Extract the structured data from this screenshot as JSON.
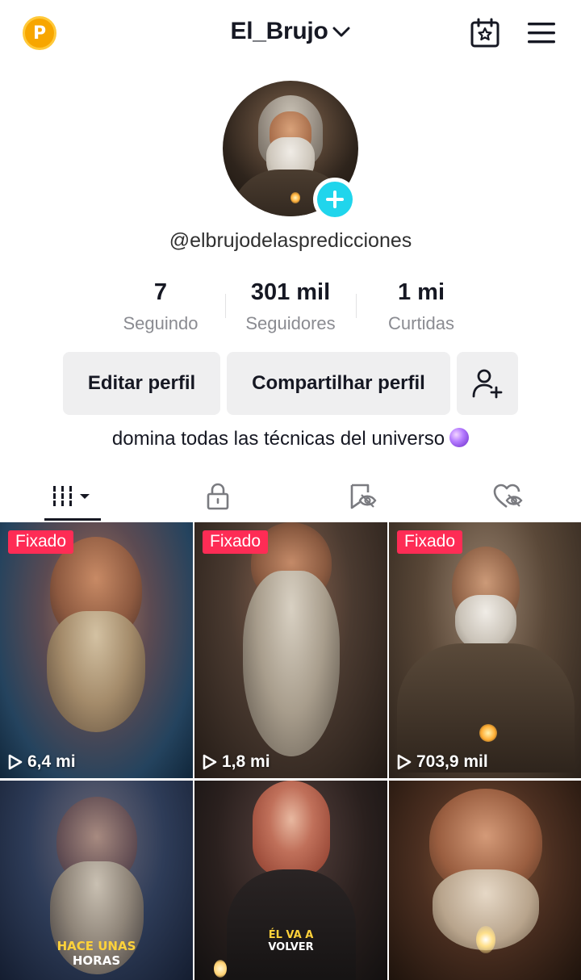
{
  "header": {
    "title": "El_Brujo",
    "coin_icon": "p-coin-icon",
    "calendar_icon": "calendar-star-icon",
    "menu_icon": "hamburger-menu-icon"
  },
  "profile": {
    "username": "@elbrujodelaspredicciones",
    "bio": "domina todas las técnicas del universo",
    "bio_emoji": "crystal-ball"
  },
  "stats": [
    {
      "value": "7",
      "label": "Seguindo"
    },
    {
      "value": "301 mil",
      "label": "Seguidores"
    },
    {
      "value": "1 mi",
      "label": "Curtidas"
    }
  ],
  "buttons": {
    "edit": "Editar perfil",
    "share": "Compartilhar perfil"
  },
  "tabs": [
    "videos-grid-icon",
    "lock-icon",
    "eye-slash-bookmark-icon",
    "heart-slash-icon"
  ],
  "videos": [
    {
      "pinned": "Fixado",
      "views": "6,4 mi"
    },
    {
      "pinned": "Fixado",
      "views": "1,8 mi"
    },
    {
      "pinned": "Fixado",
      "views": "703,9 mil"
    },
    {
      "caption_1": "HACE UNAS",
      "caption_2": "HORAS"
    },
    {
      "caption_1": "ÉL VA A",
      "caption_2": "VOLVER"
    },
    {}
  ],
  "colors": {
    "accent_pin": "#fe2c55",
    "add_button": "#20d5ec",
    "coin": "#f7a600",
    "caption_yellow": "#ffd23a"
  }
}
